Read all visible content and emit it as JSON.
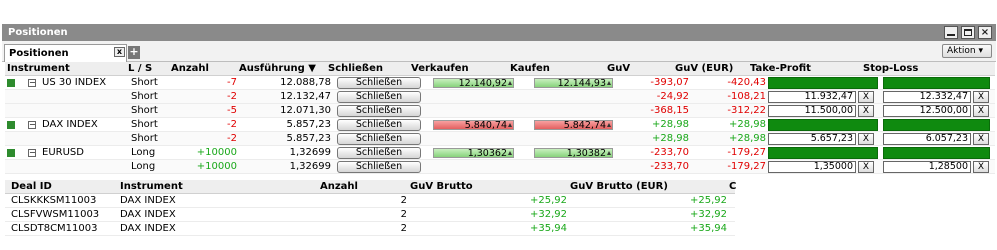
{
  "window": {
    "title": "Positionen",
    "tab_label": "Positionen",
    "tab_close": "x",
    "tab_add": "+",
    "aktion_label": "Aktion ▾",
    "close_glyph": "×"
  },
  "positions": {
    "headers": {
      "instrument": "Instrument",
      "ls": "L / S",
      "anzahl": "Anzahl",
      "ausfuehrung": "Ausführung ▼",
      "schliessen": "Schließen",
      "verkaufen": "Verkaufen",
      "kaufen": "Kaufen",
      "guv": "GuV",
      "guv_eur": "GuV (EUR)",
      "take_profit": "Take-Profit",
      "stop_loss": "Stop-Loss"
    },
    "button_label": "Schließen",
    "clear_label": "X",
    "groups": [
      {
        "instrument": "US 30 INDEX",
        "expander": "−",
        "sell": "12.140,92",
        "buy": "12.144,93",
        "quote_color": "green",
        "rows": [
          {
            "ls": "Short",
            "anzahl": "-7",
            "ausfuehrung": "12.088,78",
            "guv": "-393,07",
            "guv_eur": "-420,43",
            "tp": "",
            "sl": ""
          },
          {
            "ls": "Short",
            "anzahl": "-2",
            "ausfuehrung": "12.132,47",
            "guv": "-24,92",
            "guv_eur": "-108,21",
            "tp": "11.932,47",
            "sl": "12.332,47"
          },
          {
            "ls": "Short",
            "anzahl": "-5",
            "ausfuehrung": "12.071,30",
            "guv": "-368,15",
            "guv_eur": "-312,22",
            "tp": "11.500,00",
            "sl": "12.500,00"
          }
        ]
      },
      {
        "instrument": "DAX INDEX",
        "expander": "−",
        "sell": "5.840,74",
        "buy": "5.842,74",
        "quote_color": "red",
        "rows": [
          {
            "ls": "Short",
            "anzahl": "-2",
            "ausfuehrung": "5.857,23",
            "guv": "+28,98",
            "guv_eur": "+28,98",
            "tp": "",
            "sl": ""
          },
          {
            "ls": "Short",
            "anzahl": "-2",
            "ausfuehrung": "5.857,23",
            "guv": "+28,98",
            "guv_eur": "+28,98",
            "tp": "5.657,23",
            "sl": "6.057,23"
          }
        ]
      },
      {
        "instrument": "EURUSD",
        "expander": "−",
        "sell": "1,30362",
        "buy": "1,30382",
        "quote_color": "green",
        "rows": [
          {
            "ls": "Long",
            "anzahl": "+10000",
            "ausfuehrung": "1,32699",
            "guv": "-233,70",
            "guv_eur": "-179,27",
            "tp": "",
            "sl": ""
          },
          {
            "ls": "Long",
            "anzahl": "+10000",
            "ausfuehrung": "1,32699",
            "guv": "-233,70",
            "guv_eur": "-179,27",
            "tp": "1,35000",
            "sl": "1,28500"
          }
        ]
      }
    ]
  },
  "deals": {
    "headers": {
      "deal_id": "Deal ID",
      "instrument": "Instrument",
      "anzahl": "Anzahl",
      "guv_brutto": "GuV Brutto",
      "guv_brutto_eur": "GuV Brutto (EUR)",
      "extra": "C"
    },
    "rows": [
      {
        "deal_id": "CLSKKKSM11003",
        "instrument": "DAX INDEX",
        "anzahl": "2",
        "guv_brutto": "+25,92",
        "guv_brutto_eur": "+25,92"
      },
      {
        "deal_id": "CLSFVWSM11003",
        "instrument": "DAX INDEX",
        "anzahl": "2",
        "guv_brutto": "+32,92",
        "guv_brutto_eur": "+32,92"
      },
      {
        "deal_id": "CLSDT8CM11003",
        "instrument": "DAX INDEX",
        "anzahl": "2",
        "guv_brutto": "+35,94",
        "guv_brutto_eur": "+35,94"
      }
    ]
  },
  "colors": {
    "title_bar": "#8a8a8a",
    "negative": "#e00000",
    "positive": "#1aa81a",
    "bar_green": "#0f8a0f"
  }
}
